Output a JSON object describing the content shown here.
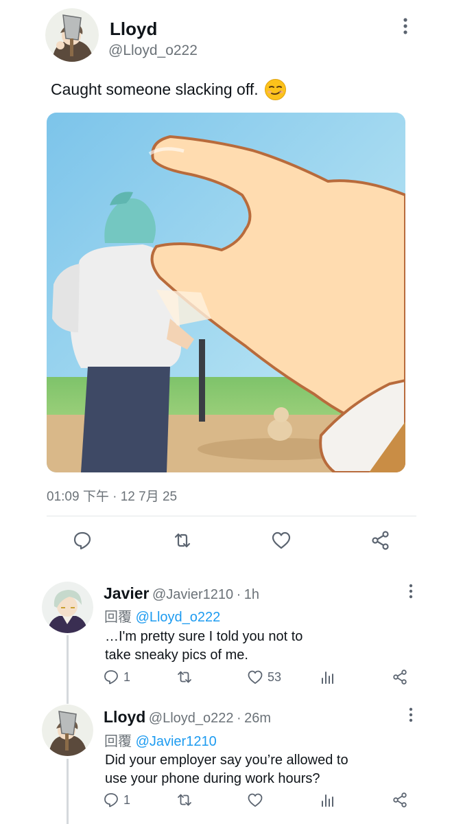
{
  "main_tweet": {
    "display_name": "Lloyd",
    "handle": "@Lloyd_o222",
    "text": "Caught someone slacking off.",
    "emoji": "smirking-face",
    "timestamp": "01:09 下午 · 12 7月 25",
    "icons": [
      "reply-icon",
      "retweet-icon",
      "like-icon",
      "share-icon"
    ]
  },
  "replies": [
    {
      "display_name": "Javier",
      "handle": "@Javier1210",
      "time": "1h",
      "reply_prefix": "回覆",
      "reply_to": "@Lloyd_o222",
      "text_line1": "…I'm pretty sure I told you not to",
      "text_line2": "take sneaky pics of me.",
      "reply_count": "1",
      "like_count": "53"
    },
    {
      "display_name": "Lloyd",
      "handle": "@Lloyd_o222",
      "time": "26m",
      "reply_prefix": "回覆",
      "reply_to": "@Javier1210",
      "text_line1": "Did your employer say you’re allowed to",
      "text_line2": "use your phone during work hours?",
      "reply_count": "1",
      "like_count": ""
    }
  ],
  "colors": {
    "accent": "#1d9bf0",
    "muted_text": "#6b7278",
    "icon": "#5b6470"
  }
}
